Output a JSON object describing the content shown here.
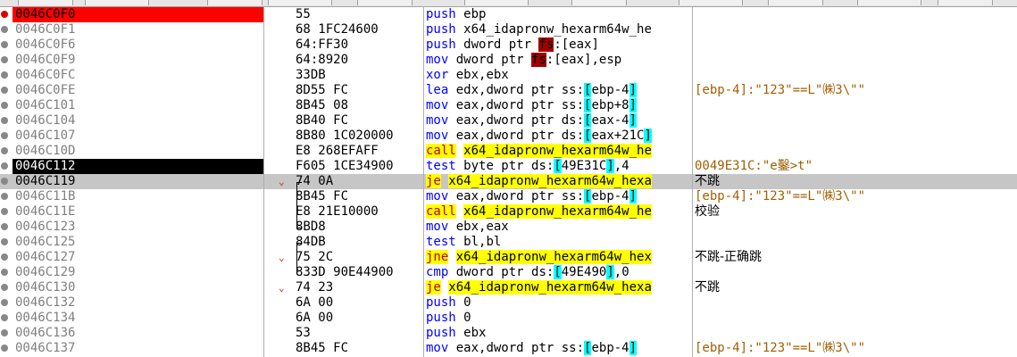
{
  "rows": [
    {
      "addr": "0046C0F0",
      "bytes": "55",
      "mnem": "push",
      "ops": [
        {
          "t": "ebp"
        }
      ],
      "comment": "",
      "addr_style": "red",
      "bp": "red"
    },
    {
      "addr": "0046C0F1",
      "bytes": "68 1FC24600",
      "mnem": "push",
      "ops": [
        {
          "t": "x64_idapronw_hexarm64w_he"
        }
      ],
      "comment": ""
    },
    {
      "addr": "0046C0F6",
      "bytes": "64:FF30",
      "mnem": "push",
      "ops": [
        {
          "t": "dword ptr "
        },
        {
          "t": "fs",
          "c": "seg"
        },
        {
          "t": ":[eax]"
        }
      ],
      "comment": ""
    },
    {
      "addr": "0046C0F9",
      "bytes": "64:8920",
      "mnem": "mov",
      "ops": [
        {
          "t": "dword ptr "
        },
        {
          "t": "fs",
          "c": "seg"
        },
        {
          "t": ":[eax],esp"
        }
      ],
      "comment": ""
    },
    {
      "addr": "0046C0FC",
      "bytes": "33DB",
      "mnem": "xor",
      "ops": [
        {
          "t": "ebx,ebx"
        }
      ],
      "comment": ""
    },
    {
      "addr": "0046C0FE",
      "bytes": "8D55 FC",
      "mnem": "lea",
      "ops": [
        {
          "t": "edx,dword ptr ss:"
        },
        {
          "t": "[",
          "c": "hl"
        },
        {
          "t": "ebp-4"
        },
        {
          "t": "]",
          "c": "hl"
        }
      ],
      "comment": "[ebp-4]:\"123\"==L\"㈱3\\\"\"",
      "cstyle": "a"
    },
    {
      "addr": "0046C101",
      "bytes": "8B45 08",
      "mnem": "mov",
      "ops": [
        {
          "t": "eax,dword ptr ss:"
        },
        {
          "t": "[",
          "c": "hl"
        },
        {
          "t": "ebp+8"
        },
        {
          "t": "]",
          "c": "hl"
        }
      ],
      "comment": ""
    },
    {
      "addr": "0046C104",
      "bytes": "8B40 FC",
      "mnem": "mov",
      "ops": [
        {
          "t": "eax,dword ptr ds:"
        },
        {
          "t": "[",
          "c": "hl"
        },
        {
          "t": "eax-4"
        },
        {
          "t": "]",
          "c": "hl"
        }
      ],
      "comment": ""
    },
    {
      "addr": "0046C107",
      "bytes": "8B80 1C020000",
      "mnem": "mov",
      "ops": [
        {
          "t": "eax,dword ptr ds:"
        },
        {
          "t": "[",
          "c": "hl"
        },
        {
          "t": "eax+21C"
        },
        {
          "t": "]",
          "c": "hl"
        }
      ],
      "comment": ""
    },
    {
      "addr": "0046C10D",
      "bytes": "E8 268EFAFF",
      "mnem": "call",
      "mstyle": "jmp",
      "ops": [
        {
          "t": "x64_idapronw_hexarm64w_he",
          "c": "tgt"
        }
      ],
      "comment": ""
    },
    {
      "addr": "0046C112",
      "bytes": "F605 1CE34900",
      "mnem": "test",
      "ops": [
        {
          "t": "byte ptr ds:"
        },
        {
          "t": "[",
          "c": "hl"
        },
        {
          "t": "49E31C"
        },
        {
          "t": "]",
          "c": "hl"
        },
        {
          "t": ",4"
        }
      ],
      "comment": "0049E31C:\"e鑿>t\"",
      "cstyle": "a",
      "addr_style": "black"
    },
    {
      "addr": "0046C119",
      "bytes": "74 0A",
      "mnem": "je",
      "mstyle": "jmp",
      "ops": [
        {
          "t": "x64_idapronw_hexarm64w_hexa",
          "c": "tgt"
        }
      ],
      "comment": "不跳",
      "cstyle": "b",
      "sel": true,
      "arrow": "⌄"
    },
    {
      "addr": "0046C11B",
      "bytes": "8B45 FC",
      "mnem": "mov",
      "ops": [
        {
          "t": "eax,dword ptr ss:"
        },
        {
          "t": "[",
          "c": "hl"
        },
        {
          "t": "ebp-4"
        },
        {
          "t": "]",
          "c": "hl"
        }
      ],
      "comment": "[ebp-4]:\"123\"==L\"㈱3\\\"\"",
      "cstyle": "a"
    },
    {
      "addr": "0046C11E",
      "bytes": "E8 21E10000",
      "mnem": "call",
      "mstyle": "jmp",
      "ops": [
        {
          "t": "x64_idapronw_hexarm64w_he",
          "c": "tgt"
        }
      ],
      "comment": "校验",
      "cstyle": "b"
    },
    {
      "addr": "0046C123",
      "bytes": "8BD8",
      "mnem": "mov",
      "ops": [
        {
          "t": "ebx,eax"
        }
      ],
      "comment": ""
    },
    {
      "addr": "0046C125",
      "bytes": "84DB",
      "mnem": "test",
      "ops": [
        {
          "t": "bl,bl"
        }
      ],
      "comment": ""
    },
    {
      "addr": "0046C127",
      "bytes": "75 2C",
      "mnem": "jne",
      "mstyle": "jmp",
      "ops": [
        {
          "t": "x64_idapronw_hexarm64w_hex",
          "c": "tgt"
        }
      ],
      "comment": "不跳-正确跳",
      "cstyle": "b",
      "arrow": "⌄"
    },
    {
      "addr": "0046C129",
      "bytes": "833D 90E44900",
      "mnem": "cmp",
      "ops": [
        {
          "t": "dword ptr ds:"
        },
        {
          "t": "[",
          "c": "hl"
        },
        {
          "t": "49E490"
        },
        {
          "t": "]",
          "c": "hl"
        },
        {
          "t": ",0"
        }
      ],
      "comment": ""
    },
    {
      "addr": "0046C130",
      "bytes": "74 23",
      "mnem": "je",
      "mstyle": "jmp",
      "ops": [
        {
          "t": "x64_idapronw_hexarm64w_hexa",
          "c": "tgt"
        }
      ],
      "comment": "不跳",
      "cstyle": "b",
      "arrow": "⌄"
    },
    {
      "addr": "0046C132",
      "bytes": "6A 00",
      "mnem": "push",
      "ops": [
        {
          "t": "0"
        }
      ],
      "comment": ""
    },
    {
      "addr": "0046C134",
      "bytes": "6A 00",
      "mnem": "push",
      "ops": [
        {
          "t": "0"
        }
      ],
      "comment": ""
    },
    {
      "addr": "0046C136",
      "bytes": "53",
      "mnem": "push",
      "ops": [
        {
          "t": "ebx"
        }
      ],
      "comment": ""
    },
    {
      "addr": "0046C137",
      "bytes": "8B45 FC",
      "mnem": "mov",
      "ops": [
        {
          "t": "eax,dword ptr ss:"
        },
        {
          "t": "[",
          "c": "hl"
        },
        {
          "t": "ebp-4"
        },
        {
          "t": "]",
          "c": "hl"
        }
      ],
      "comment": "[ebp-4]:\"123\"==L\"㈱3\\\"\"",
      "cstyle": "a"
    }
  ]
}
